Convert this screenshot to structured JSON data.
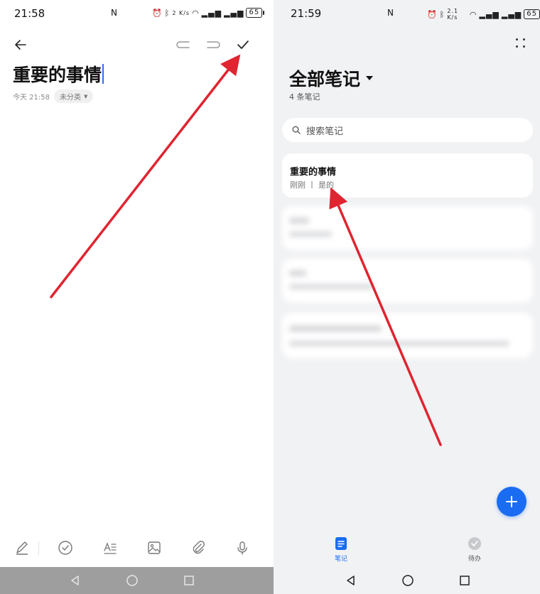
{
  "left": {
    "status": {
      "time": "21:58",
      "nfc": "N",
      "net_speed": "2 K/s",
      "battery": "65"
    },
    "toolbar": {
      "back": "back-arrow",
      "undo": "undo",
      "redo": "redo",
      "done": "check"
    },
    "note": {
      "title": "重要的事情",
      "date": "今天 21:58",
      "category": "未分类"
    },
    "tools": [
      "pen-icon",
      "checklist-icon",
      "text-format-icon",
      "image-icon",
      "attachment-icon",
      "microphone-icon"
    ]
  },
  "right": {
    "status": {
      "time": "21:59",
      "nfc": "N",
      "net_speed": "2.1 K/s",
      "battery": "65"
    },
    "header": {
      "title": "全部笔记",
      "count": "4 条笔记"
    },
    "search": {
      "placeholder": "搜索笔记"
    },
    "notes": [
      {
        "title": "重要的事情",
        "subtitle": "刚刚 丨 是的"
      }
    ],
    "tabs": [
      {
        "label": "笔记",
        "active": true
      },
      {
        "label": "待办",
        "active": false
      }
    ]
  },
  "colors": {
    "accent": "#1a6cf2",
    "arrow": "#e02430",
    "cursor": "#2f6bff"
  }
}
